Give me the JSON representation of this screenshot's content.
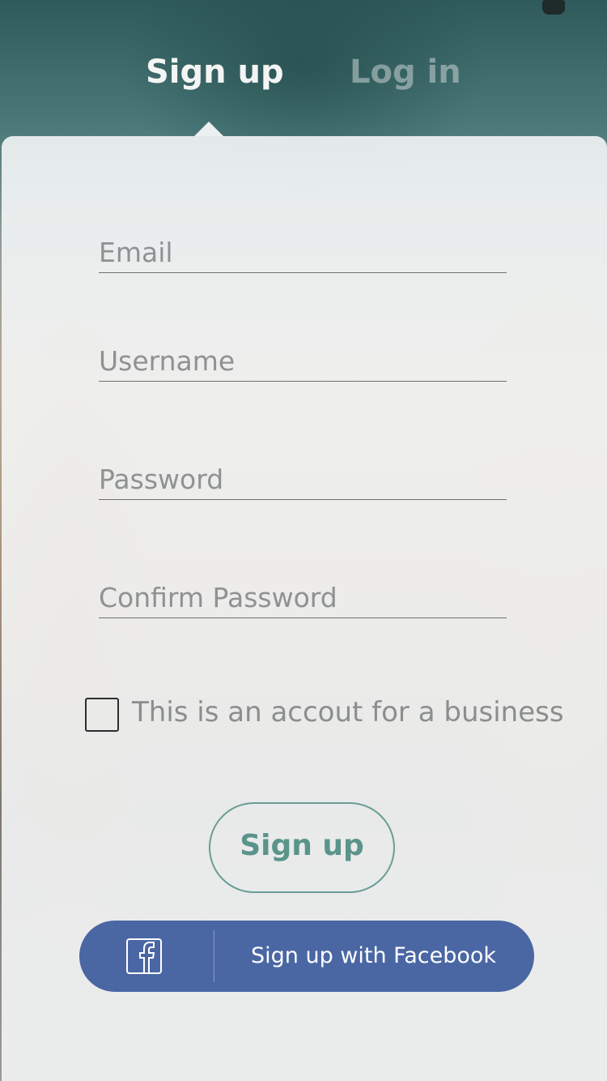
{
  "tabs": [
    {
      "label": "Sign up",
      "active": true
    },
    {
      "label": "Log in",
      "active": false
    }
  ],
  "form": {
    "email_placeholder": "Email",
    "username_placeholder": "Username",
    "password_placeholder": "Password",
    "confirm_password_placeholder": "Confirm Password",
    "business_checkbox_label": "This is an accout for a business",
    "business_checked": false,
    "signup_button_label": "Sign up",
    "facebook_button_label": "Sign up with Facebook"
  },
  "colors": {
    "accent": "#5a948b",
    "facebook": "#4a67a4",
    "card": "#f4f6f6"
  },
  "icons": {
    "facebook": "facebook-icon",
    "camera": "camera-icon"
  }
}
